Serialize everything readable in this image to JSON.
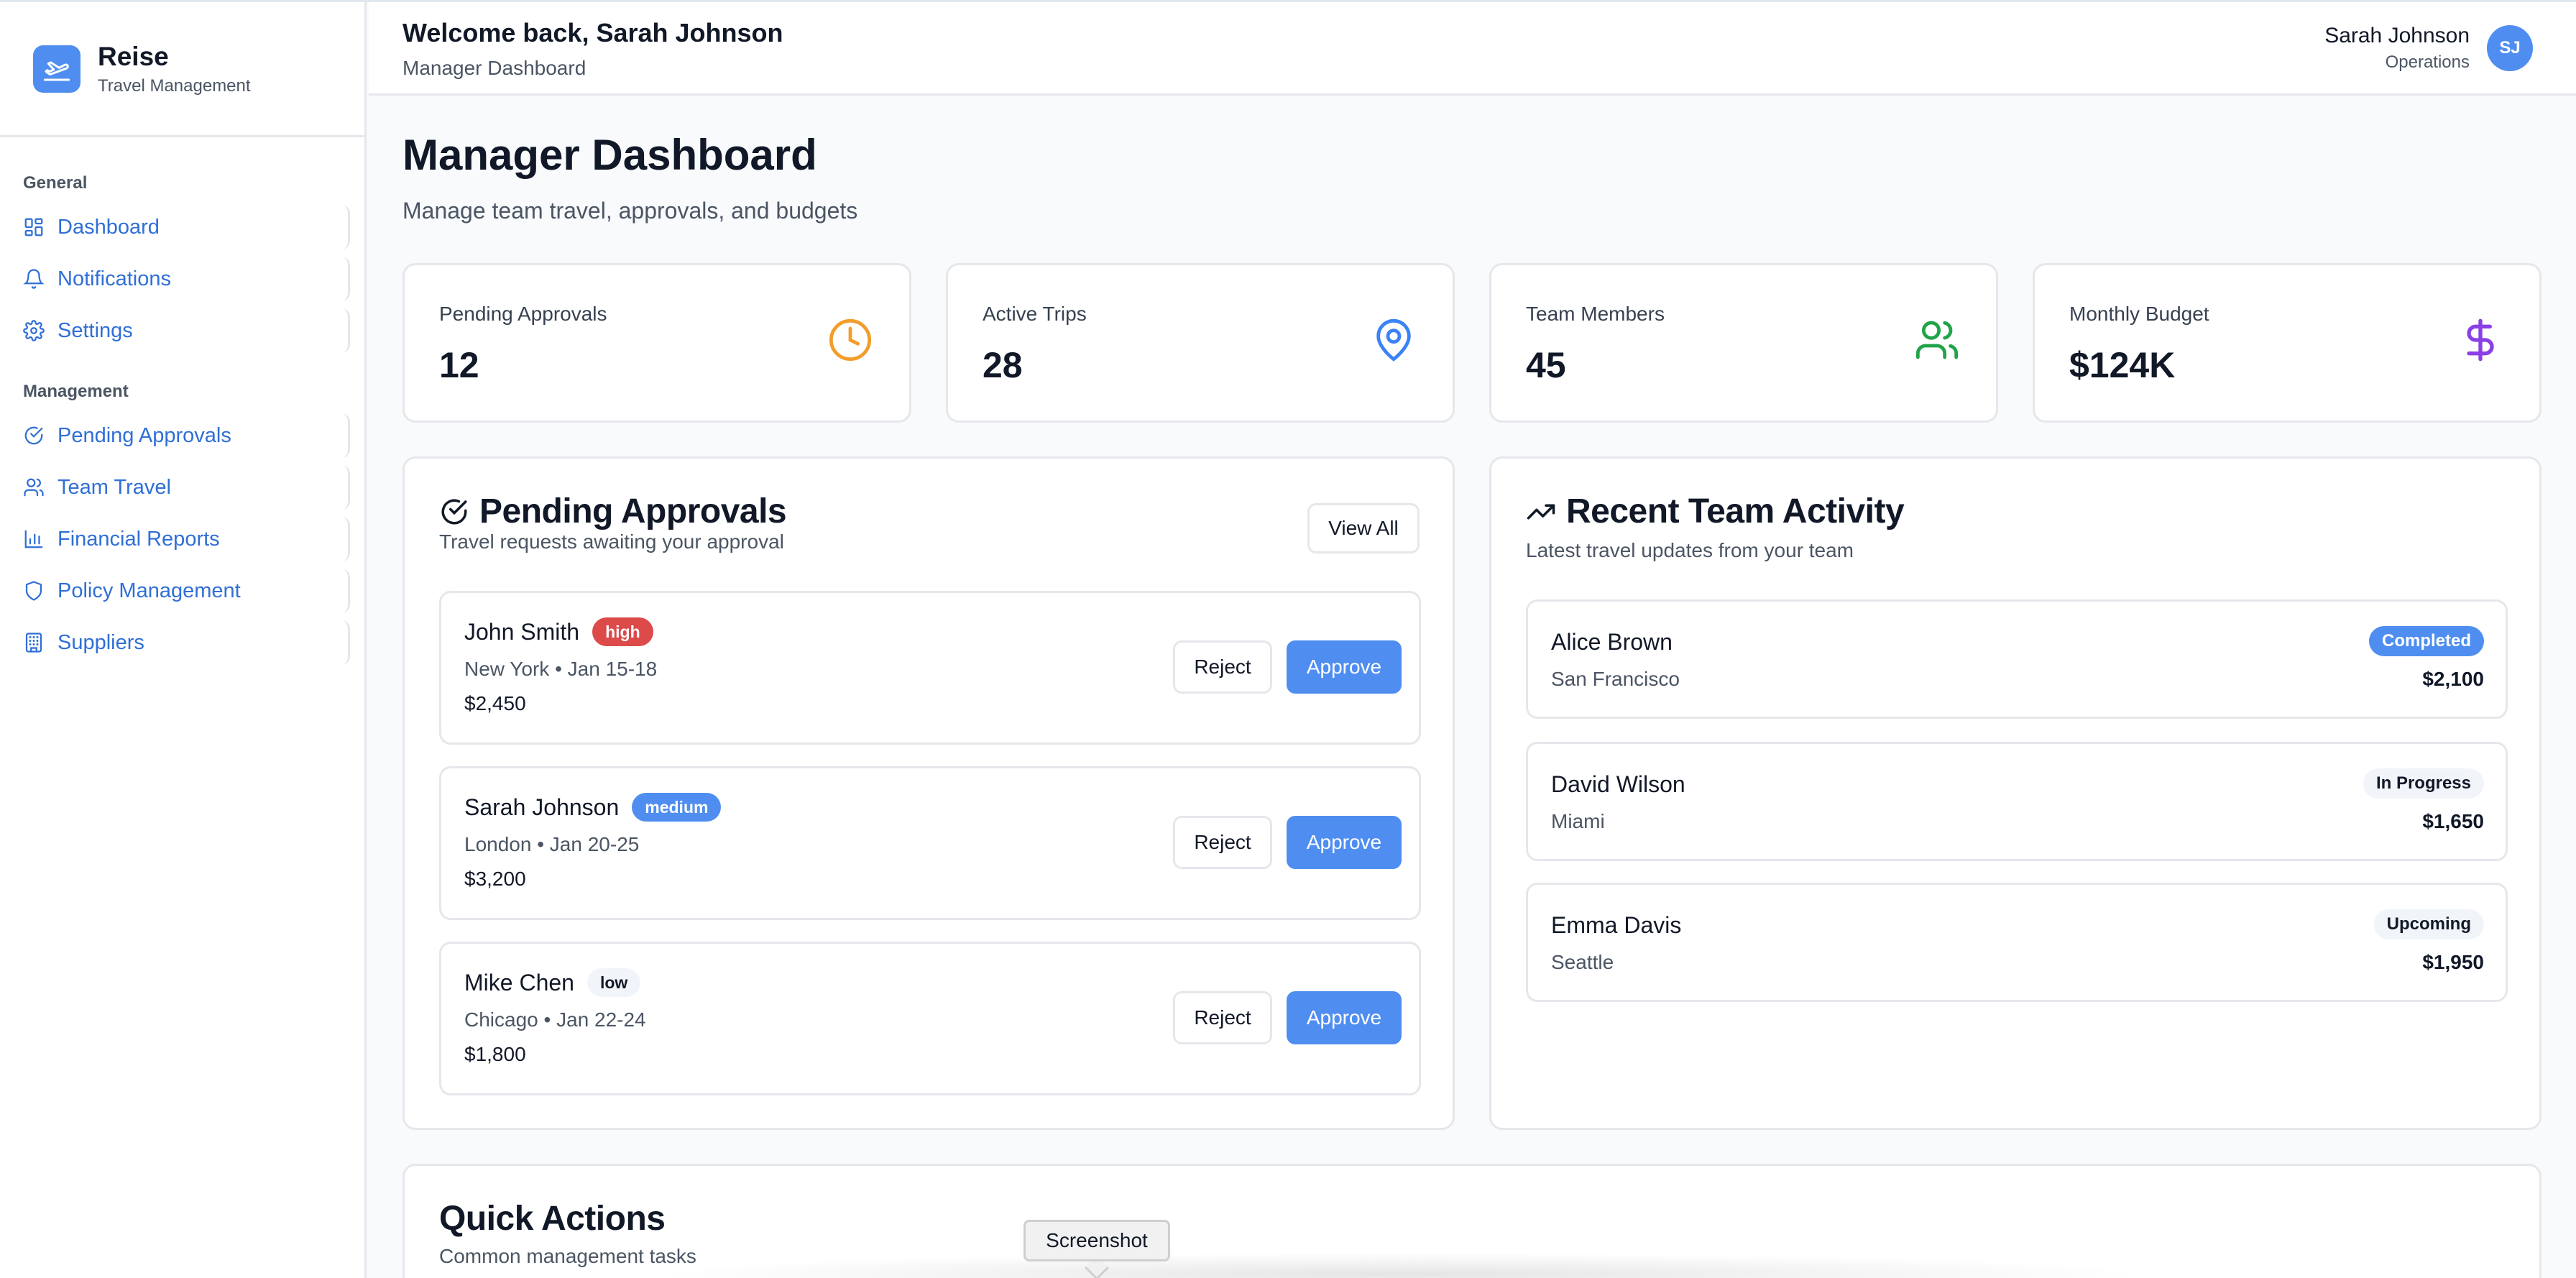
{
  "brand": {
    "name": "Reise",
    "subtitle": "Travel Management"
  },
  "sidebar": {
    "groups": [
      {
        "label": "General",
        "items": [
          {
            "label": "Dashboard",
            "icon": "dashboard-icon"
          },
          {
            "label": "Notifications",
            "icon": "bell-icon"
          },
          {
            "label": "Settings",
            "icon": "gear-icon"
          }
        ]
      },
      {
        "label": "Management",
        "items": [
          {
            "label": "Pending Approvals",
            "icon": "check-circle-icon"
          },
          {
            "label": "Team Travel",
            "icon": "users-icon"
          },
          {
            "label": "Financial Reports",
            "icon": "bar-chart-icon"
          },
          {
            "label": "Policy Management",
            "icon": "shield-icon"
          },
          {
            "label": "Suppliers",
            "icon": "building-icon"
          }
        ]
      }
    ]
  },
  "header": {
    "welcome": "Welcome back, Sarah Johnson",
    "subtitle": "Manager Dashboard",
    "user": {
      "name": "Sarah Johnson",
      "role": "Operations",
      "initials": "SJ"
    }
  },
  "main": {
    "title": "Manager Dashboard",
    "subtitle": "Manage team travel, approvals, and budgets"
  },
  "stats": [
    {
      "label": "Pending Approvals",
      "value": "12",
      "icon": "clock-icon",
      "color": "#f29d2b"
    },
    {
      "label": "Active Trips",
      "value": "28",
      "icon": "map-pin-icon",
      "color": "#3b82f6"
    },
    {
      "label": "Team Members",
      "value": "45",
      "icon": "users-icon",
      "color": "#22a34a"
    },
    {
      "label": "Monthly Budget",
      "value": "$124K",
      "icon": "dollar-icon",
      "color": "#8b3fe6"
    }
  ],
  "approvals": {
    "title": "Pending Approvals",
    "subtitle": "Travel requests awaiting your approval",
    "view_all": "View All",
    "reject_label": "Reject",
    "approve_label": "Approve",
    "items": [
      {
        "name": "John Smith",
        "priority": "high",
        "meta": "New York • Jan 15-18",
        "cost": "$2,450"
      },
      {
        "name": "Sarah Johnson",
        "priority": "medium",
        "meta": "London • Jan 20-25",
        "cost": "$3,200"
      },
      {
        "name": "Mike Chen",
        "priority": "low",
        "meta": "Chicago • Jan 22-24",
        "cost": "$1,800"
      }
    ]
  },
  "activity": {
    "title": "Recent Team Activity",
    "subtitle": "Latest travel updates from your team",
    "items": [
      {
        "name": "Alice Brown",
        "location": "San Francisco",
        "status": "Completed",
        "cost": "$2,100"
      },
      {
        "name": "David Wilson",
        "location": "Miami",
        "status": "In Progress",
        "cost": "$1,650"
      },
      {
        "name": "Emma Davis",
        "location": "Seattle",
        "status": "Upcoming",
        "cost": "$1,950"
      }
    ]
  },
  "quick_actions": {
    "title": "Quick Actions",
    "subtitle": "Common management tasks"
  },
  "tooltip": {
    "label": "Screenshot"
  },
  "colors": {
    "accent": "#4f8ef0",
    "danger": "#dc4a4a"
  }
}
